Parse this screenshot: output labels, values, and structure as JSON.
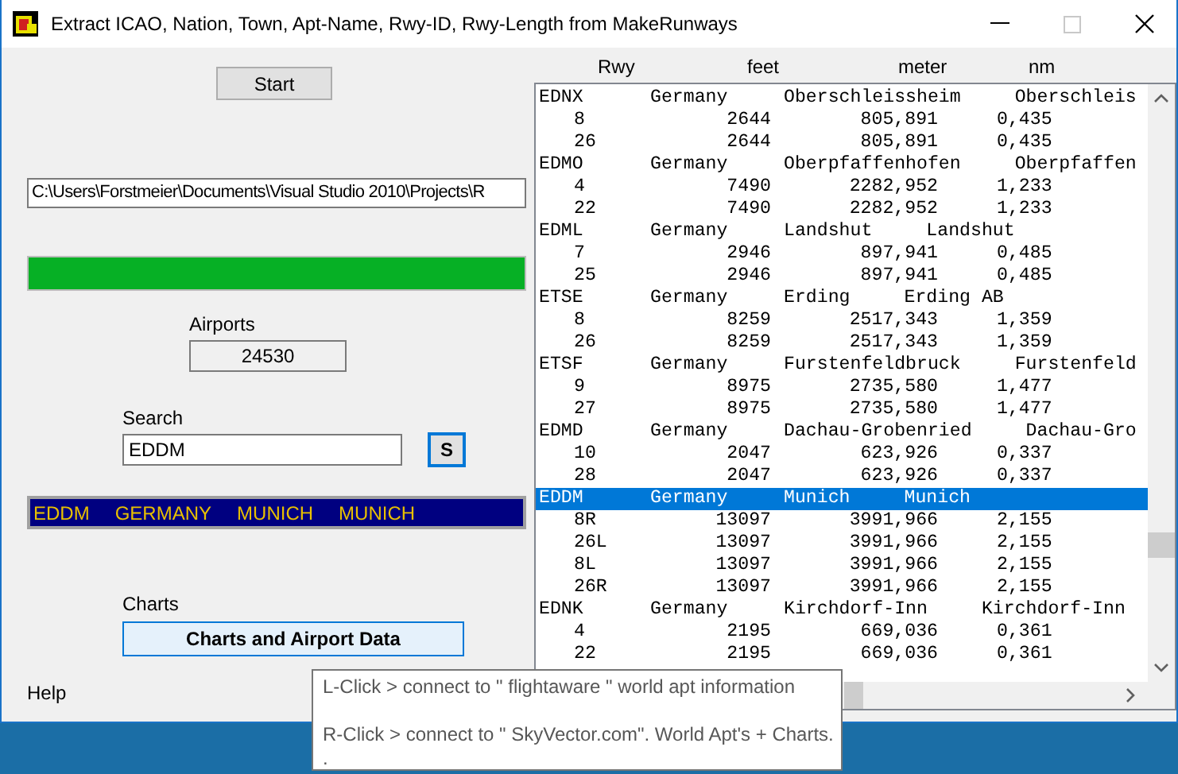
{
  "window": {
    "title": "Extract ICAO, Nation, Town, Apt-Name, Rwy-ID, Rwy-Length from MakeRunways",
    "maximize_disabled": true
  },
  "start_button": "Start",
  "path_field": {
    "value": "C:\\Users\\Forstmeier\\Documents\\Visual Studio 2010\\Projects\\R"
  },
  "progress": {
    "level": 1
  },
  "airports": {
    "label": "Airports",
    "value": "24530"
  },
  "search": {
    "label": "Search",
    "value": "EDDM",
    "button": "S"
  },
  "result": [
    "EDDM",
    "GERMANY",
    "MUNICH",
    "MUNICH"
  ],
  "charts": {
    "label": "Charts",
    "button": "Charts and Airport Data"
  },
  "help": "Help",
  "columns": [
    "Rwy",
    "feet",
    "meter",
    "nm"
  ],
  "rows": [
    {
      "kind": "airport",
      "selected": false,
      "icao": "EDNX",
      "country": "Germany",
      "town": "Oberschleissheim",
      "name": "Oberschleis"
    },
    {
      "kind": "runway",
      "selected": false,
      "rwy": "8",
      "feet": "2644",
      "meter": "805,891",
      "nm": "0,435"
    },
    {
      "kind": "runway",
      "selected": false,
      "rwy": "26",
      "feet": "2644",
      "meter": "805,891",
      "nm": "0,435"
    },
    {
      "kind": "airport",
      "selected": false,
      "icao": "EDMO",
      "country": "Germany",
      "town": "Oberpfaffenhofen",
      "name": "Oberpfaffen"
    },
    {
      "kind": "runway",
      "selected": false,
      "rwy": "4",
      "feet": "7490",
      "meter": "2282,952",
      "nm": "1,233"
    },
    {
      "kind": "runway",
      "selected": false,
      "rwy": "22",
      "feet": "7490",
      "meter": "2282,952",
      "nm": "1,233"
    },
    {
      "kind": "airport",
      "selected": false,
      "icao": "EDML",
      "country": "Germany",
      "town": "Landshut",
      "name": "Landshut"
    },
    {
      "kind": "runway",
      "selected": false,
      "rwy": "7",
      "feet": "2946",
      "meter": "897,941",
      "nm": "0,485"
    },
    {
      "kind": "runway",
      "selected": false,
      "rwy": "25",
      "feet": "2946",
      "meter": "897,941",
      "nm": "0,485"
    },
    {
      "kind": "airport",
      "selected": false,
      "icao": "ETSE",
      "country": "Germany",
      "town": "Erding",
      "name": "Erding AB"
    },
    {
      "kind": "runway",
      "selected": false,
      "rwy": "8",
      "feet": "8259",
      "meter": "2517,343",
      "nm": "1,359"
    },
    {
      "kind": "runway",
      "selected": false,
      "rwy": "26",
      "feet": "8259",
      "meter": "2517,343",
      "nm": "1,359"
    },
    {
      "kind": "airport",
      "selected": false,
      "icao": "ETSF",
      "country": "Germany",
      "town": "Furstenfeldbruck",
      "name": "Furstenfeld"
    },
    {
      "kind": "runway",
      "selected": false,
      "rwy": "9",
      "feet": "8975",
      "meter": "2735,580",
      "nm": "1,477"
    },
    {
      "kind": "runway",
      "selected": false,
      "rwy": "27",
      "feet": "8975",
      "meter": "2735,580",
      "nm": "1,477"
    },
    {
      "kind": "airport",
      "selected": false,
      "icao": "EDMD",
      "country": "Germany",
      "town": "Dachau-Grobenried",
      "name": "Dachau-Gro"
    },
    {
      "kind": "runway",
      "selected": false,
      "rwy": "10",
      "feet": "2047",
      "meter": "623,926",
      "nm": "0,337"
    },
    {
      "kind": "runway",
      "selected": false,
      "rwy": "28",
      "feet": "2047",
      "meter": "623,926",
      "nm": "0,337"
    },
    {
      "kind": "airport",
      "selected": true,
      "icao": "EDDM",
      "country": "Germany",
      "town": "Munich",
      "name": "Munich"
    },
    {
      "kind": "runway",
      "selected": false,
      "rwy": "8R",
      "feet": "13097",
      "meter": "3991,966",
      "nm": "2,155"
    },
    {
      "kind": "runway",
      "selected": false,
      "rwy": "26L",
      "feet": "13097",
      "meter": "3991,966",
      "nm": "2,155"
    },
    {
      "kind": "runway",
      "selected": false,
      "rwy": "8L",
      "feet": "13097",
      "meter": "3991,966",
      "nm": "2,155"
    },
    {
      "kind": "runway",
      "selected": false,
      "rwy": "26R",
      "feet": "13097",
      "meter": "3991,966",
      "nm": "2,155"
    },
    {
      "kind": "airport",
      "selected": false,
      "icao": "EDNK",
      "country": "Germany",
      "town": "Kirchdorf-Inn",
      "name": "Kirchdorf-Inn"
    },
    {
      "kind": "runway",
      "selected": false,
      "rwy": "4",
      "feet": "2195",
      "meter": "669,036",
      "nm": "0,361"
    },
    {
      "kind": "runway",
      "selected": false,
      "rwy": "22",
      "feet": "2195",
      "meter": "669,036",
      "nm": "0,361"
    }
  ],
  "tooltip": [
    "L-Click > connect to \" flightaware \" world apt information",
    "R-Click > connect to \" SkyVector.com\". World Apt's + Charts.",
    "."
  ]
}
